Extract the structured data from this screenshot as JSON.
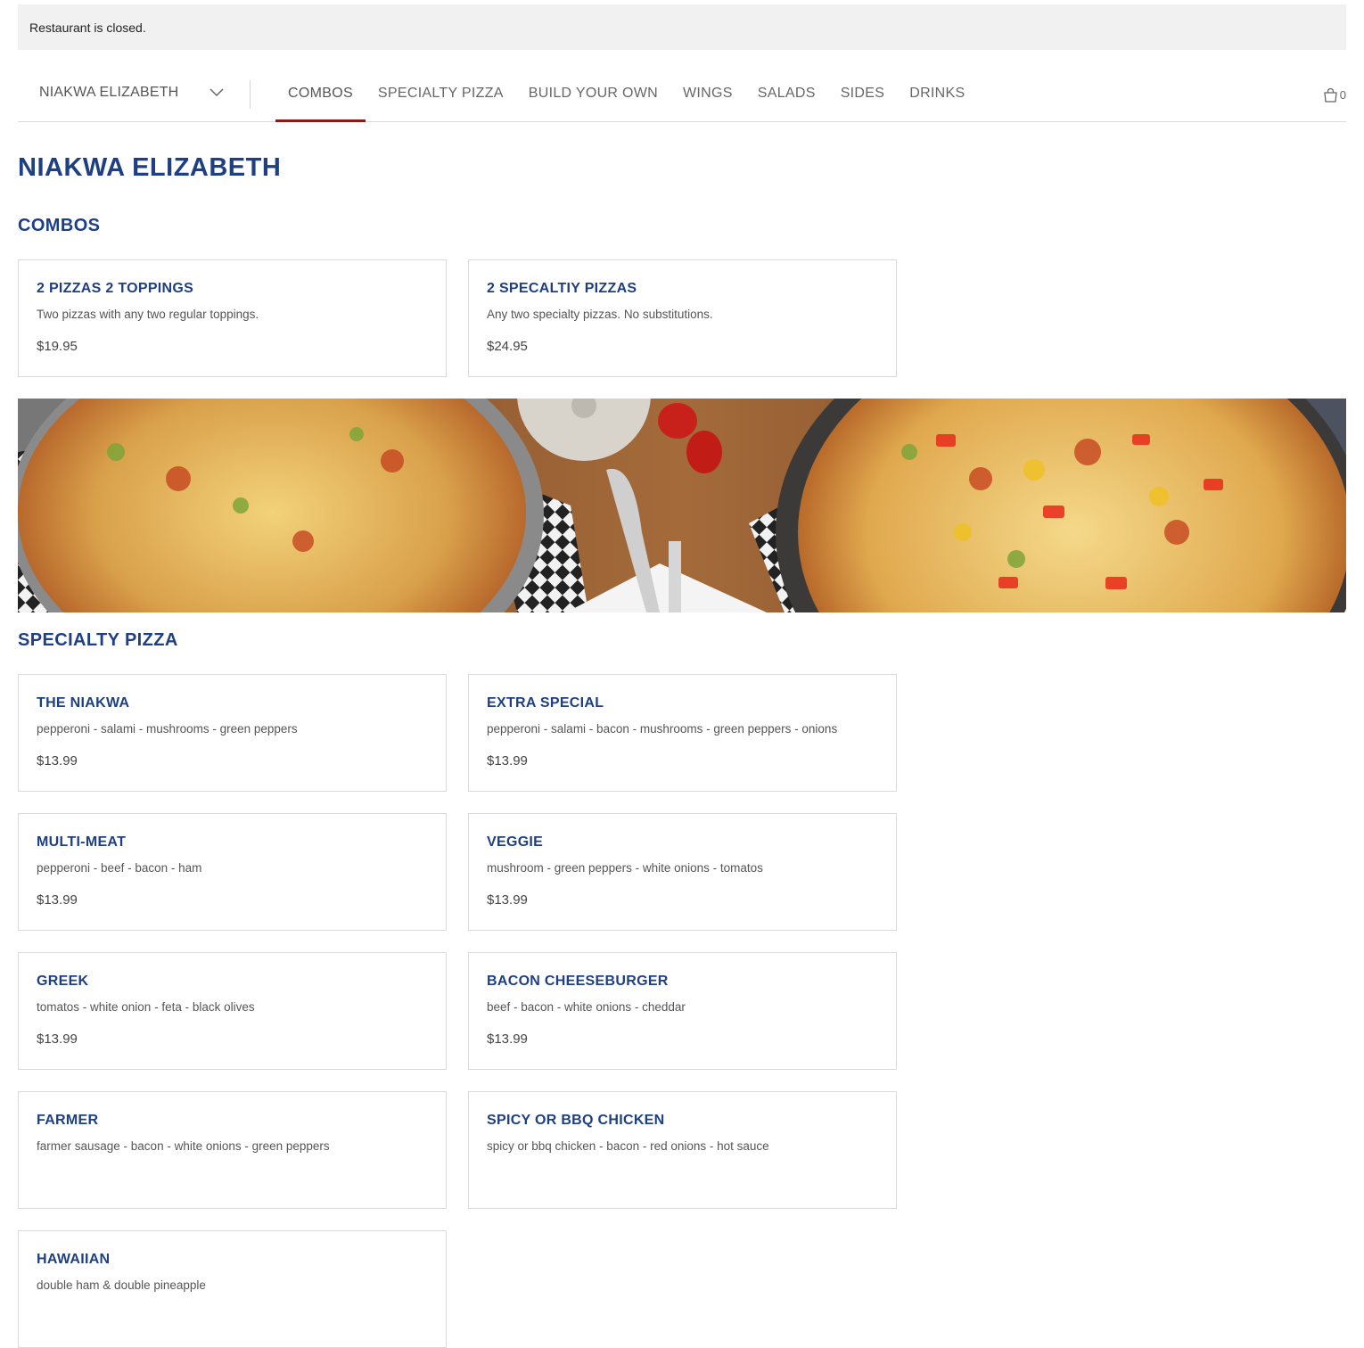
{
  "status_banner": "Restaurant is closed.",
  "location_select": {
    "value": "NIAKWA ELIZABETH"
  },
  "tabs": [
    "COMBOS",
    "SPECIALTY PIZZA",
    "BUILD YOUR OWN",
    "WINGS",
    "SALADS",
    "SIDES",
    "DRINKS"
  ],
  "active_tab": "COMBOS",
  "cart": {
    "count": "0",
    "icon": "shopping-bag-icon"
  },
  "page_title": "NIAKWA ELIZABETH",
  "sections": [
    {
      "title": "COMBOS",
      "items": [
        {
          "name": "2 PIZZAS 2 TOPPINGS",
          "description": "Two pizzas with any two regular toppings.",
          "price": "$19.95"
        },
        {
          "name": "2 SPECALTIY PIZZAS",
          "description": "Any two specialty pizzas. No substitutions.",
          "price": "$24.95"
        }
      ]
    },
    {
      "title": "SPECIALTY PIZZA",
      "items": [
        {
          "name": "THE NIAKWA",
          "description": "pepperoni - salami - mushrooms - green peppers",
          "price": "$13.99"
        },
        {
          "name": "EXTRA SPECIAL",
          "description": "pepperoni - salami - bacon - mushrooms - green peppers - onions",
          "price": "$13.99"
        },
        {
          "name": "MULTI-MEAT",
          "description": "pepperoni - beef - bacon - ham",
          "price": "$13.99"
        },
        {
          "name": "VEGGIE",
          "description": "mushroom - green peppers - white onions - tomatos",
          "price": "$13.99"
        },
        {
          "name": "GREEK",
          "description": "tomatos - white onion - feta - black olives",
          "price": "$13.99"
        },
        {
          "name": "BACON CHEESEBURGER",
          "description": "beef - bacon - white onions - cheddar",
          "price": "$13.99"
        },
        {
          "name": "FARMER",
          "description": "farmer sausage - bacon - white onions - green peppers",
          "price": ""
        },
        {
          "name": "SPICY OR BBQ CHICKEN",
          "description": "spicy or bbq chicken - bacon - red onions - hot sauce",
          "price": ""
        },
        {
          "name": "HAWAIIAN",
          "description": "double ham & double pineapple",
          "price": ""
        }
      ]
    }
  ],
  "colors": {
    "heading": "#1e3f82",
    "active_tab_underline": "#8b1a1a",
    "banner_bg": "#f1f1f1"
  }
}
